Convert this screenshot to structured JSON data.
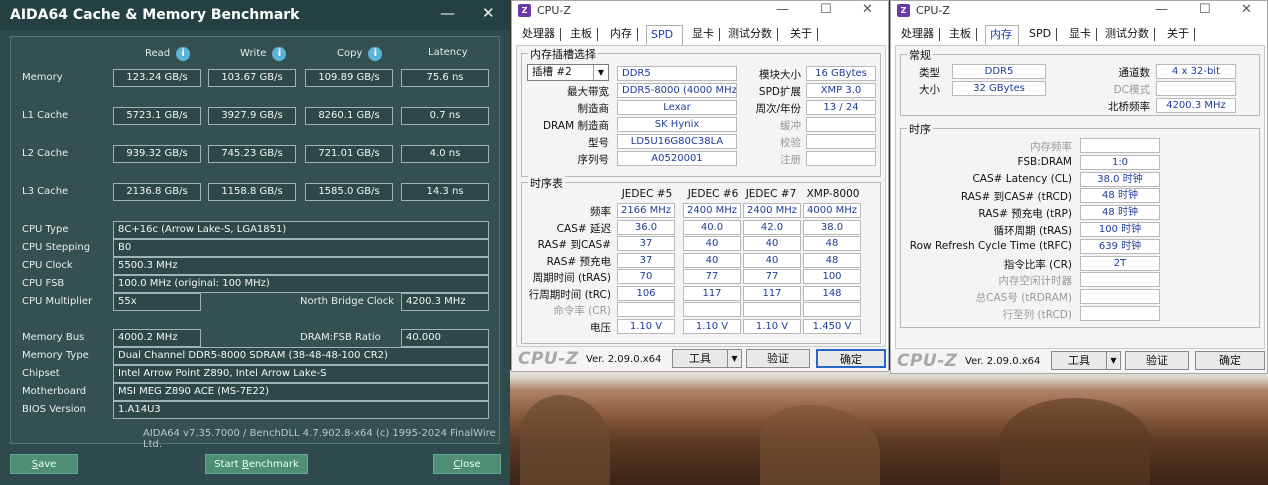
{
  "aida": {
    "title": "AIDA64 Cache & Memory Benchmark",
    "minimize": "—",
    "close": "✕",
    "headers": {
      "read": "Read",
      "write": "Write",
      "copy": "Copy",
      "latency": "Latency",
      "info_glyph": "i"
    },
    "bench_rows": [
      {
        "label": "Memory",
        "read": "123.24 GB/s",
        "write": "103.67 GB/s",
        "copy": "109.89 GB/s",
        "latency": "75.6 ns"
      },
      {
        "label": "L1 Cache",
        "read": "5723.1 GB/s",
        "write": "3927.9 GB/s",
        "copy": "8260.1 GB/s",
        "latency": "0.7 ns"
      },
      {
        "label": "L2 Cache",
        "read": "939.32 GB/s",
        "write": "745.23 GB/s",
        "copy": "721.01 GB/s",
        "latency": "4.0 ns"
      },
      {
        "label": "L3 Cache",
        "read": "2136.8 GB/s",
        "write": "1158.8 GB/s",
        "copy": "1585.0 GB/s",
        "latency": "14.3 ns"
      }
    ],
    "info": {
      "cpu_type_label": "CPU Type",
      "cpu_type": "8C+16c   (Arrow Lake-S, LGA1851)",
      "cpu_stepping_label": "CPU Stepping",
      "cpu_stepping": "B0",
      "cpu_clock_label": "CPU Clock",
      "cpu_clock": "5500.3 MHz",
      "cpu_fsb_label": "CPU FSB",
      "cpu_fsb": "100.0 MHz  (original: 100 MHz)",
      "cpu_multiplier_label": "CPU Multiplier",
      "cpu_multiplier": "55x",
      "nb_clock_label": "North Bridge Clock",
      "nb_clock": "4200.3 MHz",
      "memory_bus_label": "Memory Bus",
      "memory_bus": "4000.2 MHz",
      "dram_fsb_label": "DRAM:FSB Ratio",
      "dram_fsb": "40.000",
      "memory_type_label": "Memory Type",
      "memory_type": "Dual Channel DDR5-8000 SDRAM  (38-48-48-100 CR2)",
      "chipset_label": "Chipset",
      "chipset": "Intel Arrow Point Z890, Intel Arrow Lake-S",
      "motherboard_label": "Motherboard",
      "motherboard": "MSI MEG Z890 ACE (MS-7E22)",
      "bios_label": "BIOS Version",
      "bios": "1.A14U3"
    },
    "footer": "AIDA64 v7.35.7000 / BenchDLL 4.7.902.8-x64  (c) 1995-2024 FinalWire Ltd.",
    "buttons": {
      "save_first": "S",
      "save_rest": "ave",
      "start_pre": "Start ",
      "start_u": "B",
      "start_rest": "enchmark",
      "close_first": "C",
      "close_rest": "lose"
    }
  },
  "cpuz1": {
    "title": "CPU-Z",
    "controls": {
      "min": "—",
      "max": "☐",
      "close": "✕"
    },
    "tabs": [
      "处理器",
      "主板",
      "内存",
      "SPD",
      "显卡",
      "测试分数",
      "关于"
    ],
    "active_tab": "SPD",
    "slot_group": "内存插槽选择",
    "slot_select": "插槽 #2",
    "slot_arrow": "▼",
    "mem_type": "DDR5",
    "max_bw_label": "最大带宽",
    "max_bw": "DDR5-8000 (4000 MHz)",
    "manufacturer_label": "制造商",
    "manufacturer": "Lexar",
    "dram_mfr_label": "DRAM 制造商",
    "dram_mfr": "SK Hynix",
    "part_label": "型号",
    "part": "LD5U16G80C38LA",
    "serial_label": "序列号",
    "serial": "A0520001",
    "module_size_label": "模块大小",
    "module_size": "16 GBytes",
    "spd_ext_label": "SPD扩展",
    "spd_ext": "XMP 3.0",
    "week_year_label": "周次/年份",
    "week_year": "13 / 24",
    "buffer_label": "缓冲",
    "check_label": "校验",
    "reg_label": "注册",
    "timing_group": "时序表",
    "timing_cols": [
      "JEDEC #5",
      "JEDEC #6",
      "JEDEC #7",
      "XMP-8000"
    ],
    "timing_rows": [
      {
        "label": "频率",
        "values": [
          "2166 MHz",
          "2400 MHz",
          "2400 MHz",
          "4000 MHz"
        ]
      },
      {
        "label": "CAS# 延迟",
        "values": [
          "36.0",
          "40.0",
          "42.0",
          "38.0"
        ]
      },
      {
        "label": "RAS# 到CAS#",
        "values": [
          "37",
          "40",
          "40",
          "48"
        ]
      },
      {
        "label": "RAS# 预充电",
        "values": [
          "37",
          "40",
          "40",
          "48"
        ]
      },
      {
        "label": "周期时间 (tRAS)",
        "values": [
          "70",
          "77",
          "77",
          "100"
        ]
      },
      {
        "label": "行周期时间 (tRC)",
        "values": [
          "106",
          "117",
          "117",
          "148"
        ]
      },
      {
        "label": "命令率 (CR)",
        "values": [
          "",
          "",
          "",
          ""
        ]
      },
      {
        "label": "电压",
        "values": [
          "1.10 V",
          "1.10 V",
          "1.10 V",
          "1.450 V"
        ]
      }
    ],
    "logo": "CPU-Z",
    "version": "Ver. 2.09.0.x64",
    "tools": "工具",
    "tools_arrow": "▼",
    "validate": "验证",
    "ok": "确定"
  },
  "cpuz2": {
    "title": "CPU-Z",
    "controls": {
      "min": "—",
      "max": "☐",
      "close": "✕"
    },
    "tabs": [
      "处理器",
      "主板",
      "内存",
      "SPD",
      "显卡",
      "测试分数",
      "关于"
    ],
    "active_tab": "内存",
    "general_group": "常规",
    "type_label": "类型",
    "type": "DDR5",
    "size_label": "大小",
    "size": "32 GBytes",
    "channels_label": "通道数",
    "channels": "4 x 32-bit",
    "dc_mode_label": "DC模式",
    "nb_freq_label": "北桥频率",
    "nb_freq": "4200.3 MHz",
    "timing_group": "时序",
    "timings": [
      {
        "label": "内存频率",
        "value": "",
        "dim": true
      },
      {
        "label": "FSB:DRAM",
        "value": "1:0",
        "dim": false
      },
      {
        "label": "CAS# Latency (CL)",
        "value": "38.0 时钟",
        "dim": false
      },
      {
        "label": "RAS# 到CAS# (tRCD)",
        "value": "48 时钟",
        "dim": false
      },
      {
        "label": "RAS# 预充电 (tRP)",
        "value": "48 时钟",
        "dim": false
      },
      {
        "label": "循环周期 (tRAS)",
        "value": "100 时钟",
        "dim": false
      },
      {
        "label": "Row Refresh Cycle Time (tRFC)",
        "value": "639 时钟",
        "dim": false
      },
      {
        "label": "指令比率 (CR)",
        "value": "2T",
        "dim": false
      },
      {
        "label": "内存空闲计时器",
        "value": "",
        "dim": true
      },
      {
        "label": "总CAS号 (tRDRAM)",
        "value": "",
        "dim": true
      },
      {
        "label": "行至列 (tRCD)",
        "value": "",
        "dim": true
      }
    ],
    "logo": "CPU-Z",
    "version": "Ver. 2.09.0.x64",
    "tools": "工具",
    "tools_arrow": "▼",
    "validate": "验证",
    "ok": "确定"
  }
}
